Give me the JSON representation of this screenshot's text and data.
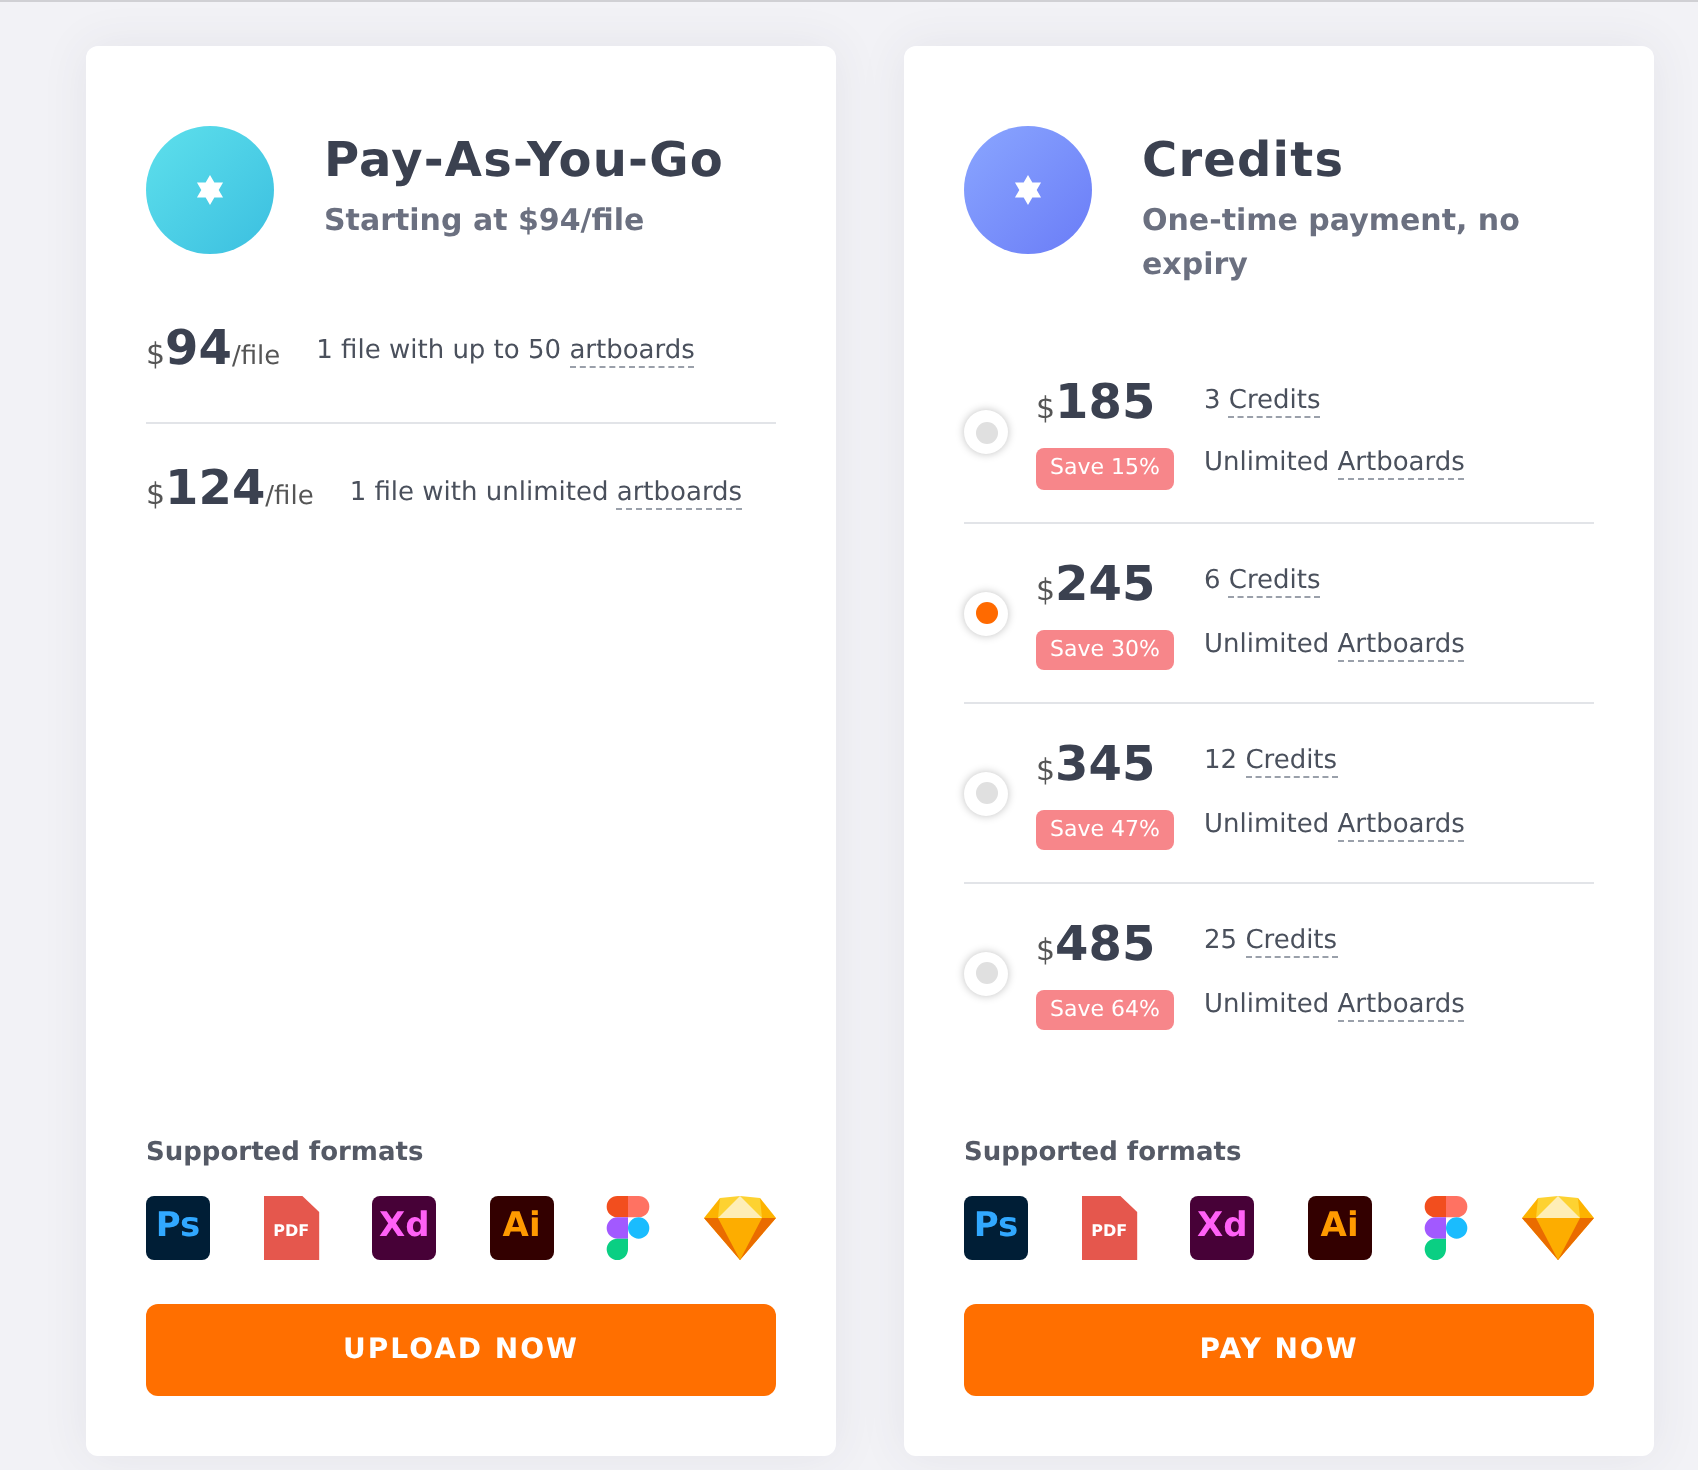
{
  "cards": [
    {
      "kind": "per_file",
      "title": "Pay-As-You-Go",
      "subtitle": "Starting at $94/file",
      "options": [
        {
          "currency": "$",
          "price": "94",
          "unit": "/file",
          "desc": "1 file with up to 50",
          "term": "artboards"
        },
        {
          "currency": "$",
          "price": "124",
          "unit": "/file",
          "desc": "1 file with unlimited",
          "term": "artboards"
        }
      ],
      "formats_label": "Supported formats",
      "formats": [
        {
          "kind": "ps",
          "label": "Ps"
        },
        {
          "kind": "pdf",
          "label": "PDF"
        },
        {
          "kind": "xd",
          "label": "Xd"
        },
        {
          "kind": "ai",
          "label": "Ai"
        },
        {
          "kind": "figma"
        },
        {
          "kind": "sketch"
        }
      ],
      "button": "UPLOAD NOW"
    },
    {
      "kind": "credits",
      "title": "Credits",
      "subtitle": "One-time payment, no expiry",
      "options": [
        {
          "selected": false,
          "currency": "$",
          "price": "185",
          "count": "3",
          "term": "Credits",
          "badge": "Save 15%",
          "feature": "Unlimited",
          "feature_term": "Artboards"
        },
        {
          "selected": true,
          "currency": "$",
          "price": "245",
          "count": "6",
          "term": "Credits",
          "badge": "Save 30%",
          "feature": "Unlimited",
          "feature_term": "Artboards"
        },
        {
          "selected": false,
          "currency": "$",
          "price": "345",
          "count": "12",
          "term": "Credits",
          "badge": "Save 47%",
          "feature": "Unlimited",
          "feature_term": "Artboards"
        },
        {
          "selected": false,
          "currency": "$",
          "price": "485",
          "count": "25",
          "term": "Credits",
          "badge": "Save 64%",
          "feature": "Unlimited",
          "feature_term": "Artboards"
        }
      ],
      "formats_label": "Supported formats",
      "formats": [
        {
          "kind": "ps",
          "label": "Ps"
        },
        {
          "kind": "pdf",
          "label": "PDF"
        },
        {
          "kind": "xd",
          "label": "Xd"
        },
        {
          "kind": "ai",
          "label": "Ai"
        },
        {
          "kind": "figma"
        },
        {
          "kind": "sketch"
        }
      ],
      "button": "PAY NOW"
    }
  ]
}
